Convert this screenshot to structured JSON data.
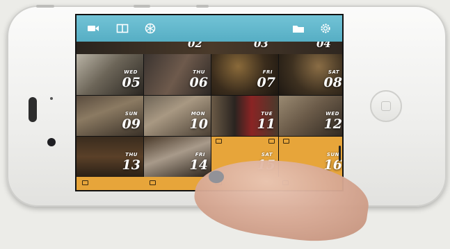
{
  "toolbar": {
    "left_icons": [
      "video-camera-icon",
      "split-view-icon",
      "snowflake-icon"
    ],
    "right_icons": [
      "folder-icon",
      "gear-icon"
    ],
    "accent": "#5db6cb"
  },
  "calendar": {
    "accent_orange": "#e7a53a",
    "top_row": [
      "02",
      "03",
      "04"
    ],
    "days": [
      {
        "weekday": "WED",
        "day": "05"
      },
      {
        "weekday": "THU",
        "day": "06"
      },
      {
        "weekday": "FRI",
        "day": "07"
      },
      {
        "weekday": "SAT",
        "day": "08"
      },
      {
        "weekday": "SUN",
        "day": "09"
      },
      {
        "weekday": "MON",
        "day": "10"
      },
      {
        "weekday": "TUE",
        "day": "11"
      },
      {
        "weekday": "WED",
        "day": "12"
      },
      {
        "weekday": "THU",
        "day": "13"
      },
      {
        "weekday": "FRI",
        "day": "14"
      },
      {
        "weekday": "SAT",
        "day": "15"
      },
      {
        "weekday": "SUN",
        "day": "16"
      }
    ]
  }
}
